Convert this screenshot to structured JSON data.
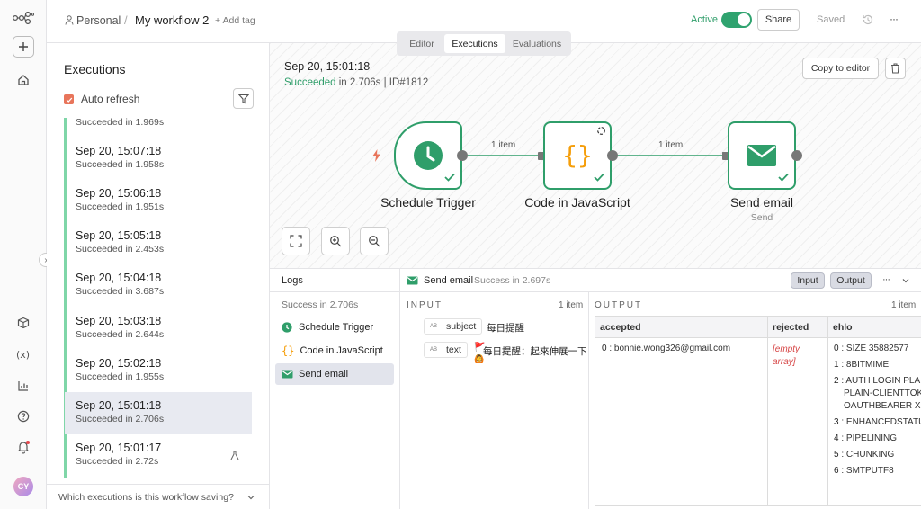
{
  "header": {
    "owner": "Personal",
    "separator": "/",
    "workflow_name": "My workflow 2",
    "add_tag": "+ Add tag",
    "active_label": "Active",
    "share_label": "Share",
    "saved_label": "Saved",
    "more_label": "···",
    "tabs": [
      {
        "label": "Editor",
        "active": false
      },
      {
        "label": "Executions",
        "active": true
      },
      {
        "label": "Evaluations",
        "active": false
      }
    ]
  },
  "sidebar_rail": {
    "avatar_initials": "CY",
    "expand_label": "›"
  },
  "executions_panel": {
    "title": "Executions",
    "auto_refresh_label": "Auto refresh",
    "auto_refresh_checked": true,
    "partial_top": "Succeeded in 1.969s",
    "items": [
      {
        "date": "Sep 20, 15:07:18",
        "status": "Succeeded in 1.958s"
      },
      {
        "date": "Sep 20, 15:06:18",
        "status": "Succeeded in 1.951s"
      },
      {
        "date": "Sep 20, 15:05:18",
        "status": "Succeeded in 2.453s"
      },
      {
        "date": "Sep 20, 15:04:18",
        "status": "Succeeded in 3.687s"
      },
      {
        "date": "Sep 20, 15:03:18",
        "status": "Succeeded in 2.644s"
      },
      {
        "date": "Sep 20, 15:02:18",
        "status": "Succeeded in 1.955s"
      },
      {
        "date": "Sep 20, 15:01:18",
        "status": "Succeeded in 2.706s"
      },
      {
        "date": "Sep 20, 15:01:17",
        "status": "Succeeded in 2.72s"
      }
    ],
    "selected_index": 6,
    "footer_question": "Which executions is this workflow saving?",
    "status_color": "#7fd6a8"
  },
  "canvas": {
    "exec_date": "Sep 20, 15:01:18",
    "exec_status": "Succeeded",
    "exec_in": " in 2.706s",
    "exec_id": "| ID#1812",
    "copy_button": "Copy to editor",
    "nodes": [
      {
        "label": "Schedule Trigger",
        "subtitle": ""
      },
      {
        "label": "Code in JavaScript",
        "subtitle": ""
      },
      {
        "label": "Send email",
        "subtitle": "Send"
      }
    ],
    "connections": [
      {
        "label": "1 item"
      },
      {
        "label": "1 item"
      }
    ],
    "success_color": "#2f9e6a",
    "code_color": "#f59e0b"
  },
  "logs": {
    "title": "Logs",
    "run_status": "Success in 2.706s",
    "steps": [
      {
        "label": "Schedule Trigger",
        "icon": "clock-icon"
      },
      {
        "label": "Code in JavaScript",
        "icon": "braces-icon"
      },
      {
        "label": "Send email",
        "icon": "envelope-icon"
      }
    ],
    "selected_step": 2,
    "node_title": "Send email",
    "node_status": "Success in 2.697s",
    "input_button": "Input",
    "output_button": "Output",
    "input": {
      "title": "INPUT",
      "count": "1 item",
      "fields": [
        {
          "key": "subject",
          "value": "每日提醒"
        },
        {
          "key": "text",
          "value": "每日提醒：起來伸展一下"
        }
      ]
    },
    "output": {
      "title": "OUTPUT",
      "count": "1 item",
      "columns": [
        "accepted",
        "rejected",
        "ehlo"
      ],
      "accepted": [
        {
          "idx": "0",
          "value": "bonnie.wong326@gmail.com"
        }
      ],
      "rejected": "[empty array]",
      "ehlo": [
        {
          "idx": "0",
          "value": "SIZE 35882577"
        },
        {
          "idx": "1",
          "value": "8BITMIME"
        },
        {
          "idx": "2",
          "value": "AUTH LOGIN PLAIN",
          "cont": [
            "PLAIN-CLIENTTOKEN",
            "OAUTHBEARER XOAUTH"
          ]
        },
        {
          "idx": "3",
          "value": "ENHANCEDSTATUSCODES"
        },
        {
          "idx": "4",
          "value": "PIPELINING"
        },
        {
          "idx": "5",
          "value": "CHUNKING"
        },
        {
          "idx": "6",
          "value": "SMTPUTF8"
        }
      ]
    }
  }
}
